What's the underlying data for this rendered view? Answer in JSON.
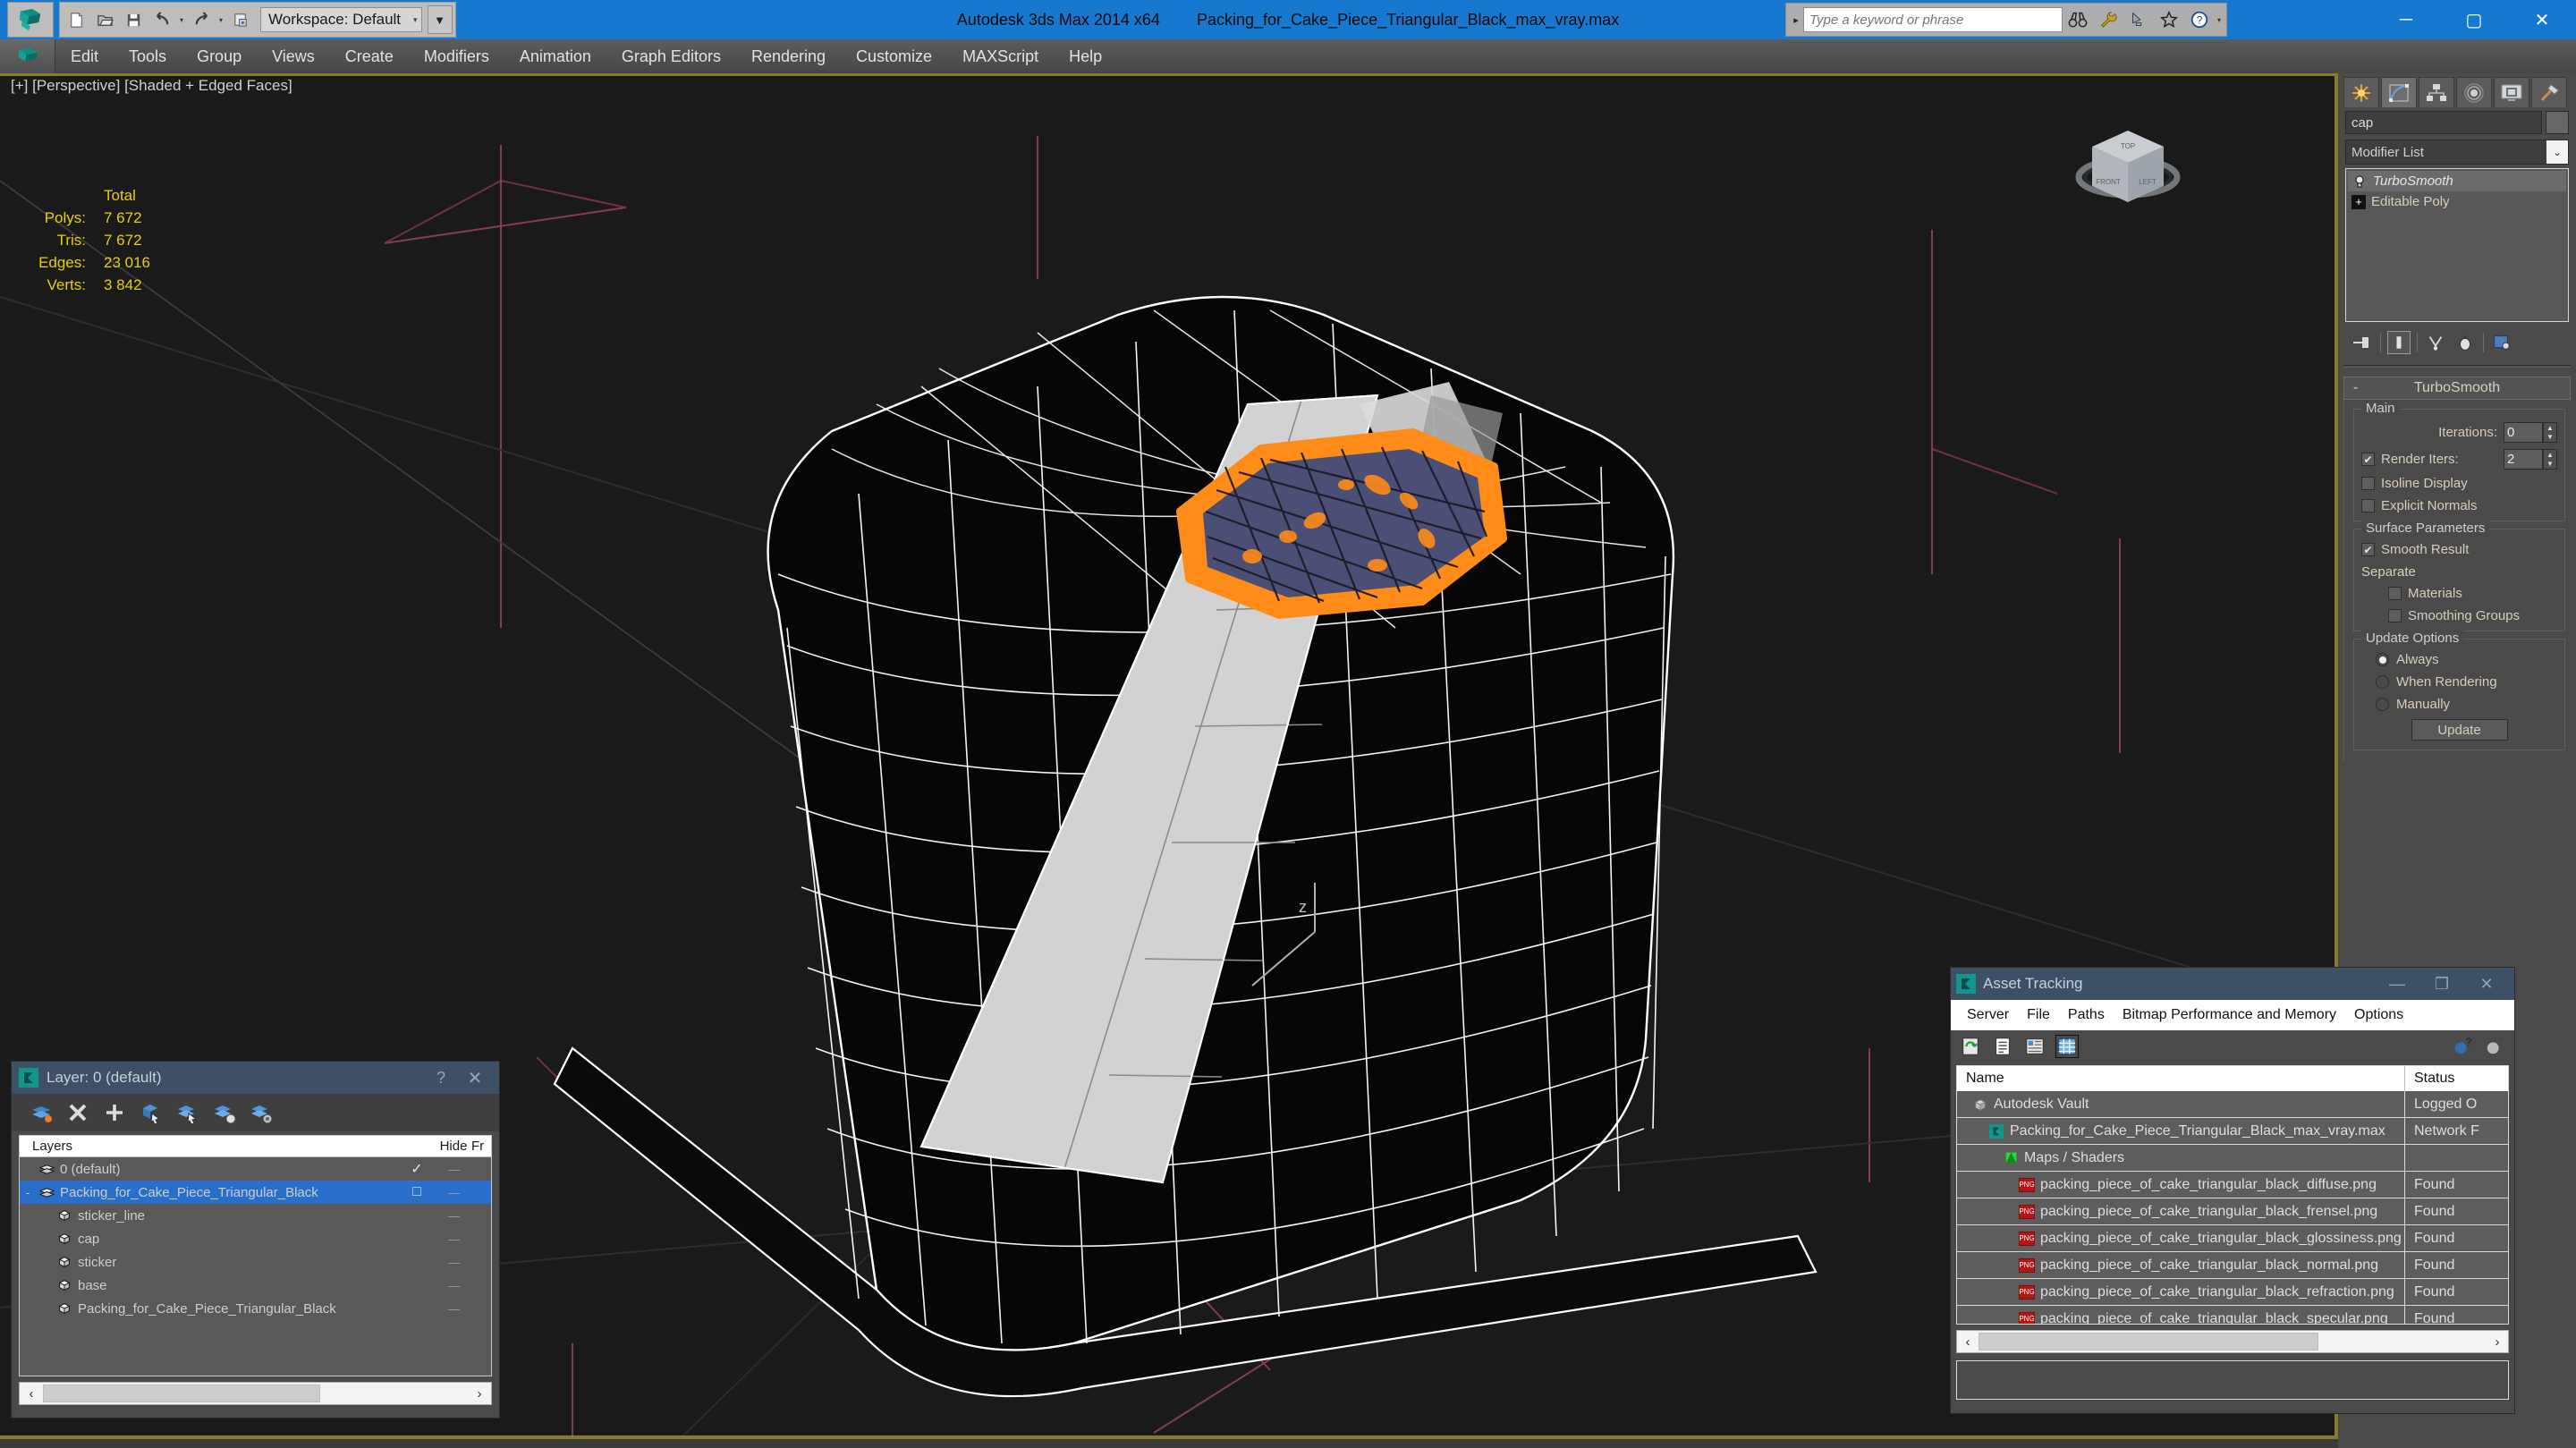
{
  "titlebar": {
    "app_title": "Autodesk 3ds Max  2014 x64",
    "file_title": "Packing_for_Cake_Piece_Triangular_Black_max_vray.max",
    "workspace_label": "Workspace: Default",
    "search_placeholder": "Type a keyword or phrase",
    "quick_access": [
      "new-icon",
      "open-icon",
      "save-icon",
      "undo-icon",
      "redo-icon",
      "project-icon"
    ],
    "search_icons": [
      "binoculars-icon",
      "wrench-icon",
      "satellite-icon",
      "star-icon",
      "help-icon"
    ],
    "window_controls": [
      "minimize",
      "maximize",
      "close"
    ],
    "accent_color": "#1678cf"
  },
  "menubar": {
    "items": [
      "Edit",
      "Tools",
      "Group",
      "Views",
      "Create",
      "Modifiers",
      "Animation",
      "Graph Editors",
      "Rendering",
      "Customize",
      "MAXScript",
      "Help"
    ]
  },
  "viewport": {
    "label": "[+] [Perspective] [Shaded + Edged Faces]",
    "stats_header": "Total",
    "stats": [
      {
        "label": "Polys:",
        "value": "7 672"
      },
      {
        "label": "Tris:",
        "value": "7 672"
      },
      {
        "label": "Edges:",
        "value": "23 016"
      },
      {
        "label": "Verts:",
        "value": "3 842"
      }
    ],
    "stats_color": "#e5d00a",
    "selection_color": "#ff8c19",
    "background_color": "#1a1a1a",
    "viewcube_faces": [
      "TOP",
      "FRONT",
      "LEFT"
    ]
  },
  "command_panel": {
    "tabs": [
      "create-tab-icon",
      "modify-tab-icon",
      "hierarchy-tab-icon",
      "motion-tab-icon",
      "display-tab-icon",
      "utilities-tab-icon"
    ],
    "active_tab_index": 1,
    "object_name": "cap",
    "modifier_list_label": "Modifier List",
    "stack": [
      {
        "name": "TurboSmooth",
        "selected": true,
        "italic": true
      },
      {
        "name": "Editable Poly",
        "selected": false,
        "italic": false
      }
    ],
    "stack_tools": [
      "pin-stack-icon",
      "show-end-result-icon",
      "make-unique-icon",
      "remove-modifier-icon",
      "configure-modifier-sets-icon"
    ],
    "rollout": {
      "title": "TurboSmooth",
      "collapse_glyph": "-",
      "groups": {
        "main": {
          "title": "Main",
          "iterations_label": "Iterations:",
          "iterations_value": "0",
          "render_iters_label": "Render Iters:",
          "render_iters_value": "2",
          "render_iters_checked": true,
          "isoline_display_label": "Isoline Display",
          "isoline_display_checked": false,
          "explicit_normals_label": "Explicit Normals",
          "explicit_normals_checked": false
        },
        "surface": {
          "title": "Surface Parameters",
          "smooth_result_label": "Smooth Result",
          "smooth_result_checked": true,
          "separate_label": "Separate",
          "materials_label": "Materials",
          "materials_checked": false,
          "smoothing_groups_label": "Smoothing Groups",
          "smoothing_groups_checked": false
        },
        "update": {
          "title": "Update Options",
          "options": [
            "Always",
            "When Rendering",
            "Manually"
          ],
          "selected_index": 0,
          "update_button_label": "Update"
        }
      }
    }
  },
  "layer_dialog": {
    "title": "Layer: 0 (default)",
    "help_glyph": "?",
    "close_glyph": "✕",
    "toolbar_icons": [
      "new-layer-icon",
      "delete-layer-icon",
      "add-layer-icon",
      "select-objects-icon",
      "select-layer-icon",
      "highlight-selected-icon",
      "layer-properties-icon"
    ],
    "columns": [
      "Layers",
      "",
      "Hide",
      "Fr"
    ],
    "rows": [
      {
        "name": "0 (default)",
        "indent": 0,
        "icon": "layer-icon",
        "check": "✓",
        "hide": "—",
        "selected": false,
        "expander": ""
      },
      {
        "name": "Packing_for_Cake_Piece_Triangular_Black",
        "indent": 0,
        "icon": "layer-icon",
        "check": "□",
        "hide": "—",
        "selected": true,
        "expander": "-"
      },
      {
        "name": "sticker_line",
        "indent": 1,
        "icon": "object-icon",
        "check": "",
        "hide": "—",
        "selected": false,
        "expander": ""
      },
      {
        "name": "cap",
        "indent": 1,
        "icon": "object-icon",
        "check": "",
        "hide": "—",
        "selected": false,
        "expander": ""
      },
      {
        "name": "sticker",
        "indent": 1,
        "icon": "object-icon",
        "check": "",
        "hide": "—",
        "selected": false,
        "expander": ""
      },
      {
        "name": "base",
        "indent": 1,
        "icon": "object-icon",
        "check": "",
        "hide": "—",
        "selected": false,
        "expander": ""
      },
      {
        "name": "Packing_for_Cake_Piece_Triangular_Black",
        "indent": 1,
        "icon": "object-icon",
        "check": "",
        "hide": "—",
        "selected": false,
        "expander": ""
      }
    ],
    "scroll_left_glyph": "‹",
    "scroll_right_glyph": "›"
  },
  "asset_tracking": {
    "title": "Asset Tracking",
    "window_controls": [
      "—",
      "❐",
      "✕"
    ],
    "menu": [
      "Server",
      "File",
      "Paths",
      "Bitmap Performance and Memory",
      "Options"
    ],
    "toolbar_icons": [
      "refresh-icon",
      "list-view-icon",
      "detail-view-icon",
      "grid-view-icon"
    ],
    "toolbar_right_icons": [
      "add-help-icon",
      "help-icon"
    ],
    "columns": [
      "Name",
      "Status"
    ],
    "rows": [
      {
        "name": "Autodesk Vault",
        "status": "Logged O",
        "indent": 0,
        "icon": "vault-icon"
      },
      {
        "name": "Packing_for_Cake_Piece_Triangular_Black_max_vray.max",
        "status": "Network F",
        "indent": 1,
        "icon": "max-file-icon"
      },
      {
        "name": "Maps / Shaders",
        "status": "",
        "indent": 2,
        "icon": "maps-icon"
      },
      {
        "name": "packing_piece_of_cake_triangular_black_diffuse.png",
        "status": "Found",
        "indent": 3,
        "icon": "png-icon"
      },
      {
        "name": "packing_piece_of_cake_triangular_black_frensel.png",
        "status": "Found",
        "indent": 3,
        "icon": "png-icon"
      },
      {
        "name": "packing_piece_of_cake_triangular_black_glossiness.png",
        "status": "Found",
        "indent": 3,
        "icon": "png-icon"
      },
      {
        "name": "packing_piece_of_cake_triangular_black_normal.png",
        "status": "Found",
        "indent": 3,
        "icon": "png-icon"
      },
      {
        "name": "packing_piece_of_cake_triangular_black_refraction.png",
        "status": "Found",
        "indent": 3,
        "icon": "png-icon"
      },
      {
        "name": "packing_piece_of_cake_triangular_black_specular.png",
        "status": "Found",
        "indent": 3,
        "icon": "png-icon"
      }
    ],
    "scroll_left_glyph": "‹",
    "scroll_right_glyph": "›"
  }
}
